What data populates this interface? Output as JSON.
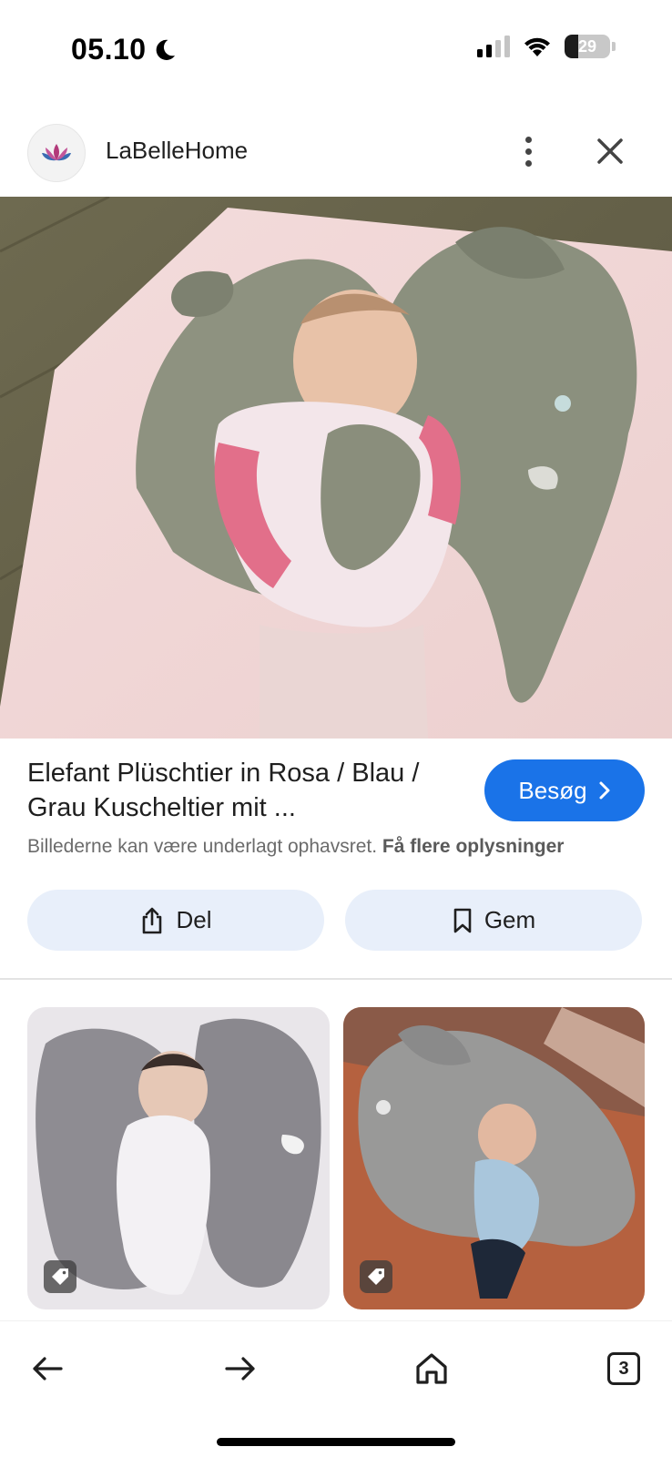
{
  "status_bar": {
    "time": "05.10",
    "battery_level": "29",
    "icons": [
      "moon-icon",
      "cellular-signal-icon",
      "wifi-icon",
      "battery-icon"
    ]
  },
  "header": {
    "site_name": "LaBelleHome",
    "icons": [
      "site-logo",
      "more-vert-icon",
      "close-icon"
    ]
  },
  "product": {
    "title": "Elefant Plüschtier in Rosa / Blau / Grau Kuscheltier mit ...",
    "visit_label": "Besøg",
    "copyright_text": "Billederne kan være underlagt ophavsret.",
    "more_info_label": "Få flere oplysninger"
  },
  "actions": {
    "share_label": "Del",
    "save_label": "Gem"
  },
  "bottom_nav": {
    "tab_count": "3",
    "icons": [
      "back-arrow-icon",
      "forward-arrow-icon",
      "home-icon",
      "tabs-icon"
    ]
  },
  "colors": {
    "accent": "#1a73e8",
    "action_button_bg": "#e8effa"
  }
}
